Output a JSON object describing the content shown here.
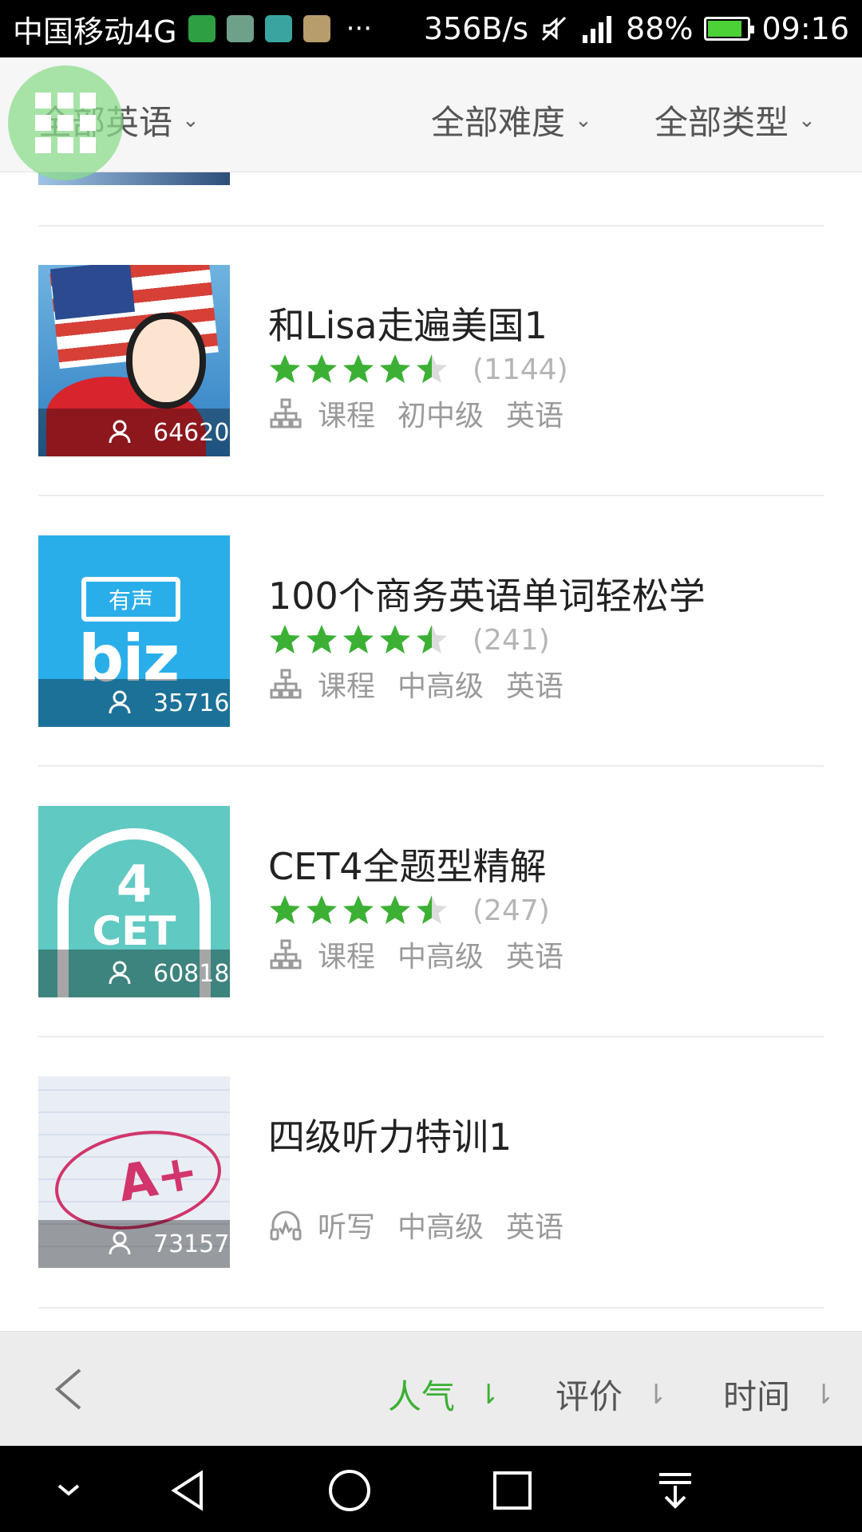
{
  "status_bar": {
    "carrier": "中国移动4G",
    "more": "···",
    "speed": "356B/s",
    "battery": "88%",
    "battery_level": 0.88,
    "time": "09:16"
  },
  "filters": {
    "language": "全部英语",
    "difficulty": "全部难度",
    "type": "全部类型"
  },
  "courses": [
    {
      "title": "和Lisa走遍美国1",
      "rating": 4.5,
      "rating_count": "(1144)",
      "learners": "64620",
      "kind": "课程",
      "level": "初中级",
      "subject": "英语",
      "kind_icon": "hierarchy-icon"
    },
    {
      "title": "100个商务英语单词轻松学",
      "rating": 4.5,
      "rating_count": "(241)",
      "learners": "35716",
      "kind": "课程",
      "level": "中高级",
      "subject": "英语",
      "kind_icon": "hierarchy-icon",
      "thumb_badge": "有声",
      "thumb_text": "biz"
    },
    {
      "title": "CET4全题型精解",
      "rating": 4.5,
      "rating_count": "(247)",
      "learners": "60818",
      "kind": "课程",
      "level": "中高级",
      "subject": "英语",
      "kind_icon": "hierarchy-icon",
      "thumb_num": "4",
      "thumb_text": "CET"
    },
    {
      "title": "四级听力特训1",
      "learners": "73157",
      "kind": "听写",
      "level": "中高级",
      "subject": "英语",
      "kind_icon": "headphones-icon",
      "thumb_text": "A+"
    }
  ],
  "sort": {
    "popularity": "人气",
    "rating": "评价",
    "time": "时间",
    "active": "popularity"
  },
  "colors": {
    "accent_green": "#3cb034",
    "star_green": "#3cb034",
    "star_empty": "#dcdcdc",
    "muted_text": "#9a9a9a"
  }
}
